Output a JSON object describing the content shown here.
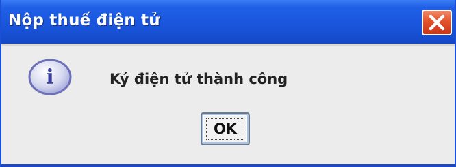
{
  "window": {
    "title": "Nộp thuế điện tử",
    "close_icon": "close-icon",
    "titlebar_color": "#1a56dd",
    "close_color": "#e4522a"
  },
  "dialog": {
    "icon": "info-icon",
    "icon_glyph": "i",
    "message": "Ký điện tử thành công",
    "ok_label": "OK"
  }
}
